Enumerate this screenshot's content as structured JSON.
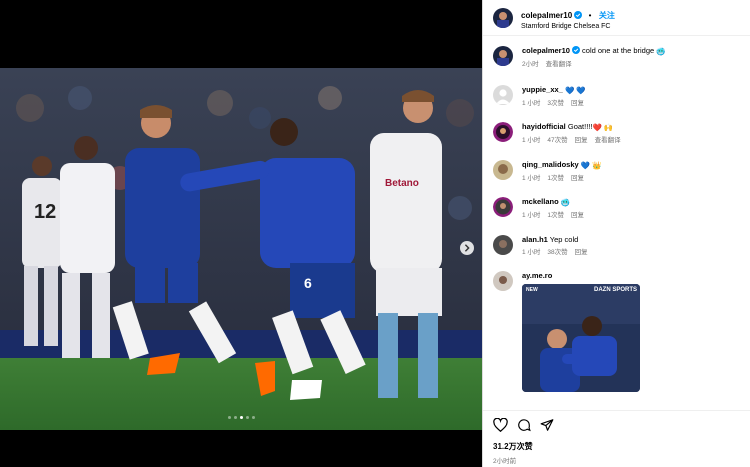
{
  "post": {
    "username": "colepalmer10",
    "separator": "•",
    "follow_label": "关注",
    "location": "Stamford Bridge Chelsea FC",
    "caption_text": "cold one at the bridge",
    "caption_time": "2小时",
    "translate_label": "查看翻译",
    "likes": "31.2万次赞",
    "posted": "2小时前"
  },
  "comments": [
    {
      "username": "yuppie_xx_",
      "text": "",
      "emoji": "💙 💙",
      "time": "1 小时",
      "likes": "3次赞",
      "reply": "回复",
      "translate": ""
    },
    {
      "username": "hayidofficial",
      "text": "Goat!!!!",
      "emoji": "❤️ 🙌",
      "time": "1 小时",
      "likes": "47次赞",
      "reply": "回复",
      "translate": "查看翻译"
    },
    {
      "username": "qing_malidosky",
      "text": "",
      "emoji": "💙 👑",
      "time": "1 小时",
      "likes": "1次赞",
      "reply": "回复",
      "translate": ""
    },
    {
      "username": "mckellano",
      "text": "",
      "emoji": "🥶",
      "time": "1 小时",
      "likes": "1次赞",
      "reply": "回复",
      "translate": ""
    },
    {
      "username": "alan.h1",
      "text": "Yep cold",
      "emoji": "",
      "time": "1 小时",
      "likes": "38次赞",
      "reply": "回复",
      "translate": ""
    },
    {
      "username": "ay.me.ro",
      "text": "",
      "emoji": "",
      "time": "",
      "likes": "",
      "reply": "",
      "translate": ""
    }
  ],
  "gif": {
    "badge": "NEW",
    "brand": "DAZN SPORTS"
  },
  "icons": [
    "verified-icon",
    "heart-icon",
    "comment-icon",
    "share-icon",
    "chevron-right-icon"
  ],
  "colors": {
    "accent": "#0095f6",
    "meta": "#737373",
    "chelsea_blue": "#1e3f9e"
  },
  "carousel": {
    "count": 5,
    "active": 2
  }
}
